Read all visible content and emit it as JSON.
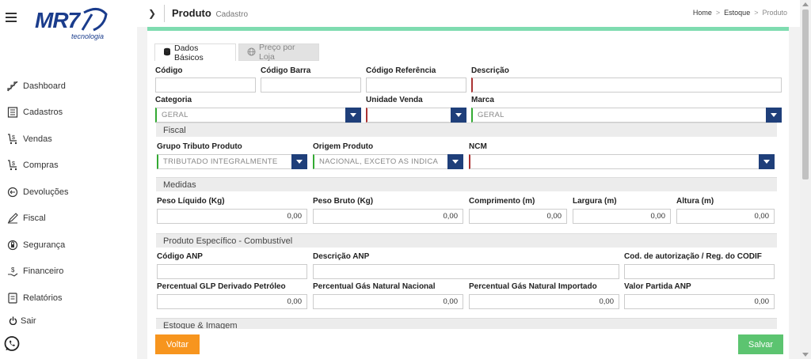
{
  "brand": {
    "logo_text": "MR7",
    "logo_sub": "tecnologia",
    "color": "#1a3c8c"
  },
  "sidebar": {
    "items": [
      {
        "label": "Dashboard",
        "icon": "stairs-icon"
      },
      {
        "label": "Cadastros",
        "icon": "list-icon"
      },
      {
        "label": "Vendas",
        "icon": "cart-dollar-icon"
      },
      {
        "label": "Compras",
        "icon": "cart-dollar-icon"
      },
      {
        "label": "Devoluções",
        "icon": "return-icon"
      },
      {
        "label": "Fiscal",
        "icon": "pen-icon"
      },
      {
        "label": "Segurança",
        "icon": "lock-user-icon"
      },
      {
        "label": "Financeiro",
        "icon": "money-hand-icon"
      },
      {
        "label": "Relatórios",
        "icon": "report-icon"
      }
    ],
    "logout": "Sair"
  },
  "header": {
    "title": "Produto",
    "subtitle": "Cadastro",
    "breadcrumb": [
      "Home",
      "Estoque",
      "Produto"
    ]
  },
  "tabs": [
    {
      "label": "Dados Básicos",
      "active": true,
      "icon": "database-icon"
    },
    {
      "label": "Preço por Loja",
      "active": false,
      "icon": "globe-icon"
    }
  ],
  "form": {
    "codigo": {
      "label": "Código",
      "value": ""
    },
    "codigo_barra": {
      "label": "Código Barra",
      "value": ""
    },
    "codigo_referencia": {
      "label": "Código Referência",
      "value": ""
    },
    "descricao": {
      "label": "Descrição",
      "value": ""
    },
    "categoria": {
      "label": "Categoria",
      "value": "GERAL"
    },
    "unidade_venda": {
      "label": "Unidade Venda",
      "value": ""
    },
    "marca": {
      "label": "Marca",
      "value": "GERAL"
    }
  },
  "fiscal": {
    "title": "Fiscal",
    "grupo_tributo": {
      "label": "Grupo Tributo Produto",
      "value": "TRIBUTADO INTEGRALMENTE"
    },
    "origem": {
      "label": "Origem Produto",
      "value": "NACIONAL, EXCETO AS INDICA"
    },
    "ncm": {
      "label": "NCM",
      "value": ""
    }
  },
  "medidas": {
    "title": "Medidas",
    "peso_liquido": {
      "label": "Peso Líquido (Kg)",
      "value": "0,00"
    },
    "peso_bruto": {
      "label": "Peso Bruto (Kg)",
      "value": "0,00"
    },
    "comprimento": {
      "label": "Comprimento (m)",
      "value": "0,00"
    },
    "largura": {
      "label": "Largura (m)",
      "value": "0,00"
    },
    "altura": {
      "label": "Altura (m)",
      "value": "0,00"
    }
  },
  "combustivel": {
    "title": "Produto Específico - Combustível",
    "codigo_anp": {
      "label": "Código ANP",
      "value": ""
    },
    "descricao_anp": {
      "label": "Descrição ANP",
      "value": ""
    },
    "codif": {
      "label": "Cod. de autorização / Reg. do CODIF",
      "value": ""
    },
    "perc_glp": {
      "label": "Percentual GLP Derivado Petróleo",
      "value": "0,00"
    },
    "perc_gn_nacional": {
      "label": "Percentual Gás Natural Nacional",
      "value": "0,00"
    },
    "perc_gn_importado": {
      "label": "Percentual Gás Natural Importado",
      "value": "0,00"
    },
    "valor_partida": {
      "label": "Valor Partida ANP",
      "value": "0,00"
    }
  },
  "estoque": {
    "title": "Estoque & Imagem"
  },
  "actions": {
    "back": "Voltar",
    "save": "Salvar"
  },
  "colors": {
    "accent": "#7fdcb0",
    "dropdown": "#1f3f7a",
    "back": "#f7951e",
    "save": "#5cc470",
    "required": "#aa3333",
    "valid": "#33aa33"
  }
}
